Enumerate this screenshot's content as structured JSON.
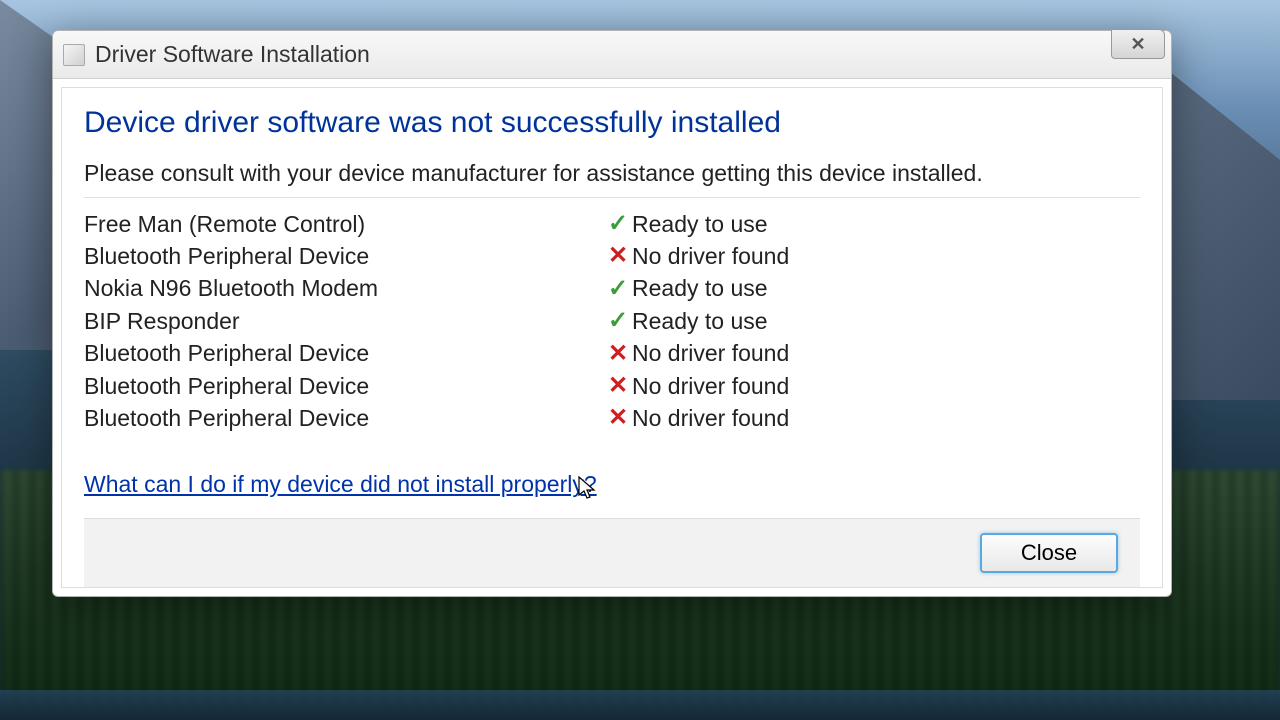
{
  "window": {
    "title": "Driver Software Installation",
    "close_x": "✕"
  },
  "heading": "Device driver software was not successfully installed",
  "subtext": "Please consult with your device manufacturer for assistance getting this device installed.",
  "devices": [
    {
      "name": "Free Man (Remote Control)",
      "status": "Ready to use",
      "ok": true
    },
    {
      "name": "Bluetooth Peripheral Device",
      "status": "No driver found",
      "ok": false
    },
    {
      "name": "Nokia N96 Bluetooth Modem",
      "status": "Ready to use",
      "ok": true
    },
    {
      "name": "BIP Responder",
      "status": "Ready to use",
      "ok": true
    },
    {
      "name": "Bluetooth Peripheral Device",
      "status": "No driver found",
      "ok": false
    },
    {
      "name": "Bluetooth Peripheral Device",
      "status": "No driver found",
      "ok": false
    },
    {
      "name": "Bluetooth Peripheral Device",
      "status": "No driver found",
      "ok": false
    }
  ],
  "help_link": "What can I do if my device did not install properly?",
  "buttons": {
    "close": "Close"
  },
  "icons": {
    "check": "✓",
    "cross": "✕"
  }
}
